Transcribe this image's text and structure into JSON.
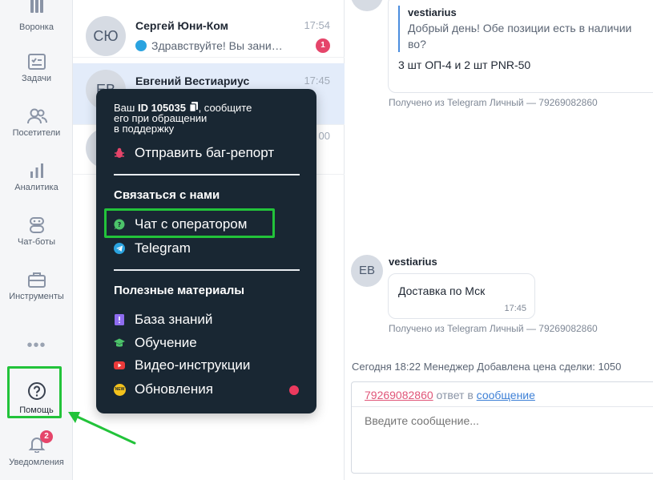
{
  "nav": {
    "items": [
      {
        "label": "Воронка",
        "icon": "funnel-icon"
      },
      {
        "label": "Задачи",
        "icon": "tasks-icon"
      },
      {
        "label": "Посетители",
        "icon": "visitors-icon"
      },
      {
        "label": "Аналитика",
        "icon": "analytics-icon"
      },
      {
        "label": "Чат-боты",
        "icon": "chatbot-icon"
      },
      {
        "label": "Инструменты",
        "icon": "toolbox-icon"
      }
    ],
    "more": "•••",
    "help": {
      "label": "Помощь",
      "icon": "help-icon"
    },
    "notifications": {
      "label": "Уведомления",
      "icon": "bell-icon",
      "badge": "2"
    }
  },
  "chats": [
    {
      "initials": "СЮ",
      "name": "Сергей Юни-Ком",
      "time": "17:54",
      "preview": "Здравствуйте! Вы зани…",
      "unread": "1"
    },
    {
      "initials": "ЕВ",
      "name": "Евгений Вестиариус",
      "time": "17:45",
      "preview": ""
    },
    {
      "initials": "",
      "name": "",
      "time": "00",
      "preview": "?"
    }
  ],
  "conversation": {
    "msg1": {
      "quote_author": "vestiarius",
      "quote_text_1": "Добрый день! Обе позиции есть в наличии",
      "quote_text_2": "во?",
      "text": "3 шт ОП-4 и 2 шт PNR-50",
      "meta": "Получено из Telegram Личный — 79269082860"
    },
    "msg2": {
      "avatar": "EB",
      "sender": "vestiarius",
      "text": "Доставка по Мск",
      "time": "17:45",
      "meta": "Получено из Telegram Личный — 79269082860"
    },
    "system_event": "Сегодня 18:22  Менеджер Добавлена цена сделки: 1050",
    "reply": {
      "phone": "79269082860",
      "middle": " ответ в ",
      "link": "сообщение"
    },
    "input_placeholder": "Введите сообщение..."
  },
  "popup": {
    "id_line_prefix": "Ваш ",
    "id_value": "ID 105035",
    "id_line_suffix": ", сообщите",
    "id_line_2": "его при обращении",
    "id_line_3": "в поддержку",
    "bug_report": "Отправить баг-репорт",
    "contact_heading": "Связаться с нами",
    "operator_chat": "Чат с оператором",
    "telegram": "Telegram",
    "materials_heading": "Полезные материалы",
    "knowledge_base": "База знаний",
    "training": "Обучение",
    "video": "Видео-инструкции",
    "updates": "Обновления",
    "new_badge": "NEW"
  },
  "colors": {
    "accent_green": "#22c33a",
    "popup_bg": "#192733",
    "badge_red": "#e5456a",
    "telegram_blue": "#2aa3e0",
    "link_blue": "#3c7fd6"
  }
}
